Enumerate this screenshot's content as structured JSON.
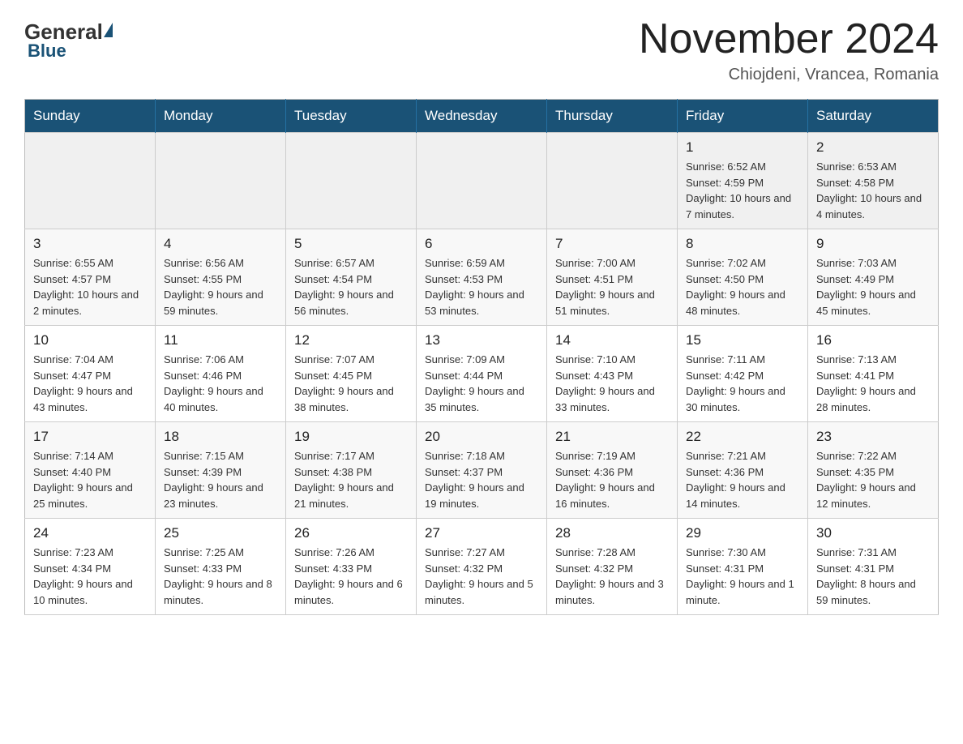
{
  "header": {
    "logo": {
      "general": "General",
      "blue": "Blue"
    },
    "title": "November 2024",
    "subtitle": "Chiojdeni, Vrancea, Romania"
  },
  "calendar": {
    "weekdays": [
      "Sunday",
      "Monday",
      "Tuesday",
      "Wednesday",
      "Thursday",
      "Friday",
      "Saturday"
    ],
    "weeks": [
      [
        {
          "day": "",
          "info": ""
        },
        {
          "day": "",
          "info": ""
        },
        {
          "day": "",
          "info": ""
        },
        {
          "day": "",
          "info": ""
        },
        {
          "day": "",
          "info": ""
        },
        {
          "day": "1",
          "info": "Sunrise: 6:52 AM\nSunset: 4:59 PM\nDaylight: 10 hours and 7 minutes."
        },
        {
          "day": "2",
          "info": "Sunrise: 6:53 AM\nSunset: 4:58 PM\nDaylight: 10 hours and 4 minutes."
        }
      ],
      [
        {
          "day": "3",
          "info": "Sunrise: 6:55 AM\nSunset: 4:57 PM\nDaylight: 10 hours and 2 minutes."
        },
        {
          "day": "4",
          "info": "Sunrise: 6:56 AM\nSunset: 4:55 PM\nDaylight: 9 hours and 59 minutes."
        },
        {
          "day": "5",
          "info": "Sunrise: 6:57 AM\nSunset: 4:54 PM\nDaylight: 9 hours and 56 minutes."
        },
        {
          "day": "6",
          "info": "Sunrise: 6:59 AM\nSunset: 4:53 PM\nDaylight: 9 hours and 53 minutes."
        },
        {
          "day": "7",
          "info": "Sunrise: 7:00 AM\nSunset: 4:51 PM\nDaylight: 9 hours and 51 minutes."
        },
        {
          "day": "8",
          "info": "Sunrise: 7:02 AM\nSunset: 4:50 PM\nDaylight: 9 hours and 48 minutes."
        },
        {
          "day": "9",
          "info": "Sunrise: 7:03 AM\nSunset: 4:49 PM\nDaylight: 9 hours and 45 minutes."
        }
      ],
      [
        {
          "day": "10",
          "info": "Sunrise: 7:04 AM\nSunset: 4:47 PM\nDaylight: 9 hours and 43 minutes."
        },
        {
          "day": "11",
          "info": "Sunrise: 7:06 AM\nSunset: 4:46 PM\nDaylight: 9 hours and 40 minutes."
        },
        {
          "day": "12",
          "info": "Sunrise: 7:07 AM\nSunset: 4:45 PM\nDaylight: 9 hours and 38 minutes."
        },
        {
          "day": "13",
          "info": "Sunrise: 7:09 AM\nSunset: 4:44 PM\nDaylight: 9 hours and 35 minutes."
        },
        {
          "day": "14",
          "info": "Sunrise: 7:10 AM\nSunset: 4:43 PM\nDaylight: 9 hours and 33 minutes."
        },
        {
          "day": "15",
          "info": "Sunrise: 7:11 AM\nSunset: 4:42 PM\nDaylight: 9 hours and 30 minutes."
        },
        {
          "day": "16",
          "info": "Sunrise: 7:13 AM\nSunset: 4:41 PM\nDaylight: 9 hours and 28 minutes."
        }
      ],
      [
        {
          "day": "17",
          "info": "Sunrise: 7:14 AM\nSunset: 4:40 PM\nDaylight: 9 hours and 25 minutes."
        },
        {
          "day": "18",
          "info": "Sunrise: 7:15 AM\nSunset: 4:39 PM\nDaylight: 9 hours and 23 minutes."
        },
        {
          "day": "19",
          "info": "Sunrise: 7:17 AM\nSunset: 4:38 PM\nDaylight: 9 hours and 21 minutes."
        },
        {
          "day": "20",
          "info": "Sunrise: 7:18 AM\nSunset: 4:37 PM\nDaylight: 9 hours and 19 minutes."
        },
        {
          "day": "21",
          "info": "Sunrise: 7:19 AM\nSunset: 4:36 PM\nDaylight: 9 hours and 16 minutes."
        },
        {
          "day": "22",
          "info": "Sunrise: 7:21 AM\nSunset: 4:36 PM\nDaylight: 9 hours and 14 minutes."
        },
        {
          "day": "23",
          "info": "Sunrise: 7:22 AM\nSunset: 4:35 PM\nDaylight: 9 hours and 12 minutes."
        }
      ],
      [
        {
          "day": "24",
          "info": "Sunrise: 7:23 AM\nSunset: 4:34 PM\nDaylight: 9 hours and 10 minutes."
        },
        {
          "day": "25",
          "info": "Sunrise: 7:25 AM\nSunset: 4:33 PM\nDaylight: 9 hours and 8 minutes."
        },
        {
          "day": "26",
          "info": "Sunrise: 7:26 AM\nSunset: 4:33 PM\nDaylight: 9 hours and 6 minutes."
        },
        {
          "day": "27",
          "info": "Sunrise: 7:27 AM\nSunset: 4:32 PM\nDaylight: 9 hours and 5 minutes."
        },
        {
          "day": "28",
          "info": "Sunrise: 7:28 AM\nSunset: 4:32 PM\nDaylight: 9 hours and 3 minutes."
        },
        {
          "day": "29",
          "info": "Sunrise: 7:30 AM\nSunset: 4:31 PM\nDaylight: 9 hours and 1 minute."
        },
        {
          "day": "30",
          "info": "Sunrise: 7:31 AM\nSunset: 4:31 PM\nDaylight: 8 hours and 59 minutes."
        }
      ]
    ]
  }
}
